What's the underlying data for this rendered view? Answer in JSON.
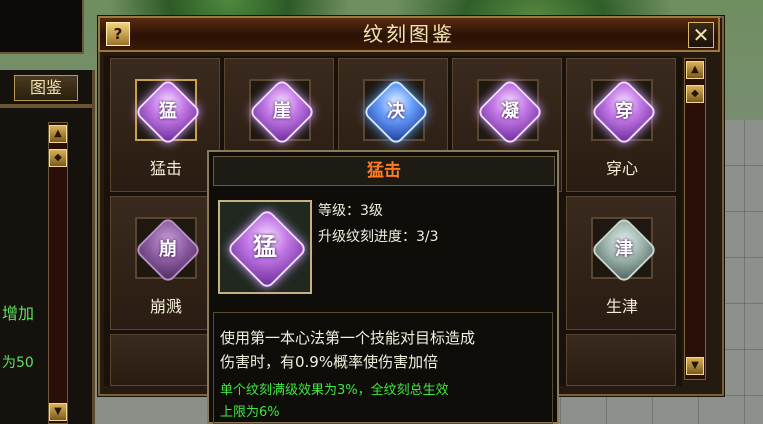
{
  "left_panel": {
    "tab_label": "图鉴",
    "text_increase": "增加",
    "text_value": "为50"
  },
  "window": {
    "title": "纹刻图鉴",
    "help_label": "?",
    "close_label": "✕"
  },
  "cells": [
    {
      "name": "猛击",
      "glyph": "猛",
      "style": "purple"
    },
    {
      "name": "",
      "glyph": "崖",
      "style": "purple"
    },
    {
      "name": "",
      "glyph": "决",
      "style": "blue"
    },
    {
      "name": "",
      "glyph": "凝",
      "style": "purple"
    },
    {
      "name": "穿心",
      "glyph": "穿",
      "style": "purple"
    },
    {
      "name": "崩溅",
      "glyph": "崩",
      "style": "dim"
    },
    {
      "name": "生津",
      "glyph": "津",
      "style": "jade"
    }
  ],
  "tooltip": {
    "title": "猛击",
    "glyph": "猛",
    "level": "等级：3级",
    "progress": "升级纹刻进度：3/3",
    "desc_line1": "使用第一本心法第一个技能对目标造成",
    "desc_line2": "伤害时，有0.9%概率使伤害加倍",
    "green_line1": "单个纹刻满级效果为3%，全纹刻总生效",
    "green_line2": "上限为6%"
  },
  "icons": {
    "scroll_up": "scroll-up-icon",
    "scroll_down": "scroll-down-icon",
    "scroll_thumb": "scroll-thumb-icon"
  }
}
